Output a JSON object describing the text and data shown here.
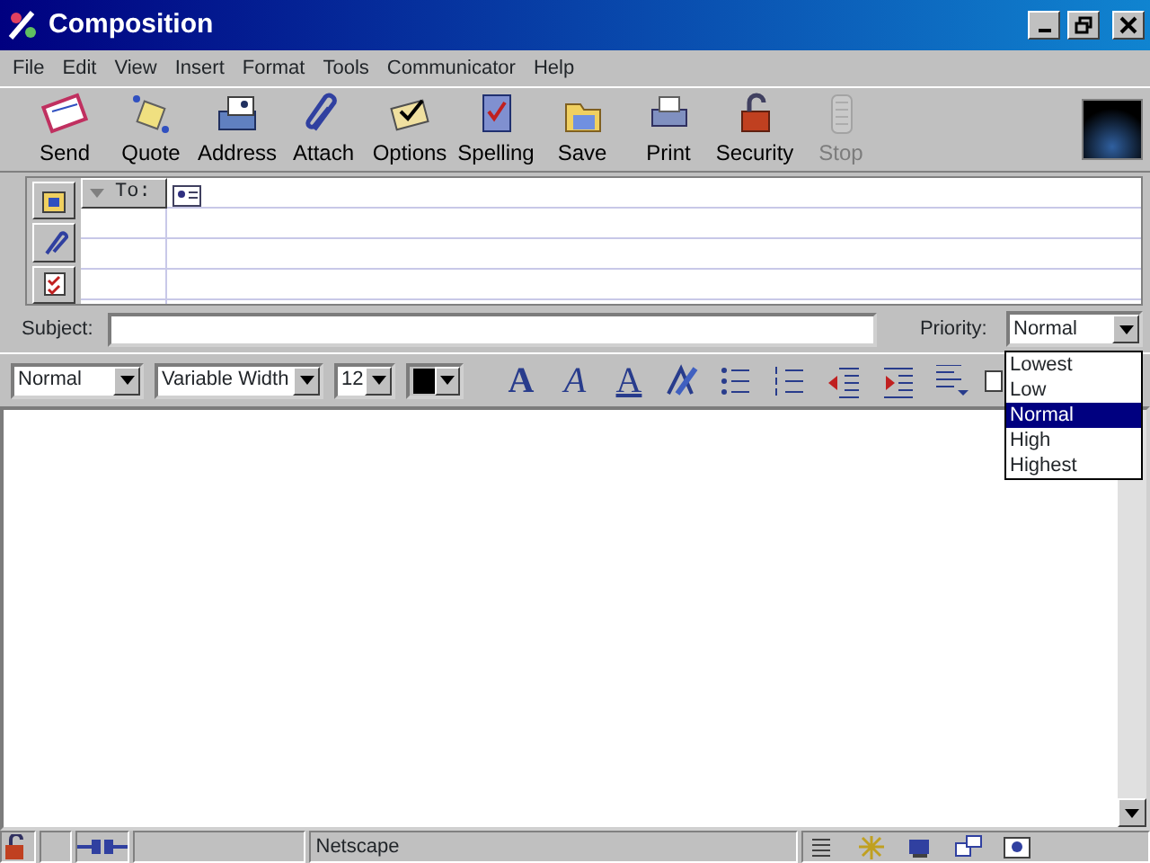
{
  "window": {
    "title": "Composition"
  },
  "menu": [
    "File",
    "Edit",
    "View",
    "Insert",
    "Format",
    "Tools",
    "Communicator",
    "Help"
  ],
  "toolbar": [
    {
      "kind": "send",
      "label": "Send",
      "disabled": false
    },
    {
      "kind": "quote",
      "label": "Quote",
      "disabled": false
    },
    {
      "kind": "address",
      "label": "Address",
      "disabled": false
    },
    {
      "kind": "attach",
      "label": "Attach",
      "disabled": false
    },
    {
      "kind": "options",
      "label": "Options",
      "disabled": false
    },
    {
      "kind": "spelling",
      "label": "Spelling",
      "disabled": false
    },
    {
      "kind": "save",
      "label": "Save",
      "disabled": false
    },
    {
      "kind": "print",
      "label": "Print",
      "disabled": false
    },
    {
      "kind": "security",
      "label": "Security",
      "disabled": false
    },
    {
      "kind": "stop",
      "label": "Stop",
      "disabled": true
    }
  ],
  "address": {
    "to_label": "To:"
  },
  "subject": {
    "label": "Subject:"
  },
  "priority": {
    "label": "Priority:",
    "value": "Normal",
    "options": [
      {
        "label": "Lowest",
        "selected": false
      },
      {
        "label": "Low",
        "selected": false
      },
      {
        "label": "Normal",
        "selected": true
      },
      {
        "label": "High",
        "selected": false
      },
      {
        "label": "Highest",
        "selected": false
      }
    ]
  },
  "format": {
    "paragraph": "Normal",
    "font": "Variable Width",
    "size": "12",
    "buttons": [
      {
        "kind": "bold",
        "glyph": "A"
      },
      {
        "kind": "italic",
        "glyph": "A"
      },
      {
        "kind": "underline",
        "glyph": "A"
      },
      {
        "kind": "clear"
      },
      {
        "kind": "bullets"
      },
      {
        "kind": "numbers"
      },
      {
        "kind": "outdent"
      },
      {
        "kind": "indent"
      },
      {
        "kind": "align"
      }
    ]
  },
  "status_bar": {
    "text": "Netscape"
  }
}
